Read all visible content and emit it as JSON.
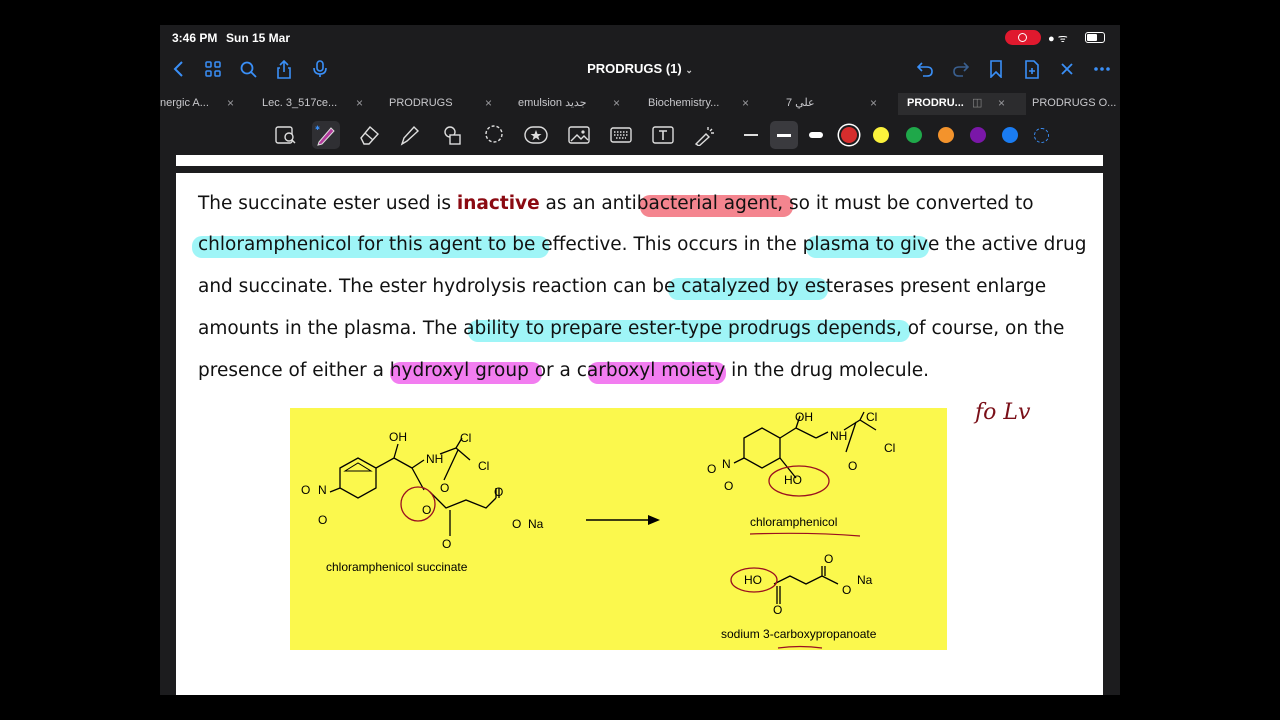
{
  "status": {
    "time": "3:46 PM",
    "date": "Sun 15 Mar"
  },
  "nav": {
    "title": "PRODRUGS (1)"
  },
  "tabs": [
    {
      "label": "nergic A..."
    },
    {
      "label": "Lec. 3_517ce..."
    },
    {
      "label": "PRODRUGS"
    },
    {
      "label": "emulsion جديد"
    },
    {
      "label": "Biochemistry..."
    },
    {
      "label": "علي 7"
    },
    {
      "label": "PRODRU..."
    },
    {
      "label": "PRODRUGS O..."
    }
  ],
  "colors": {
    "accent": "#3a8ff7",
    "pink_highlight": "#f4858f",
    "cyan_highlight": "#9ff5f7",
    "magenta_highlight": "#f27df0",
    "page_background": "#ffffff",
    "scheme_background": "#fbf84d"
  },
  "palette": [
    "#d62d2d",
    "#fbf23c",
    "#1fa84a",
    "#f3932c",
    "#7a17a8",
    "#1a7cf2"
  ],
  "document": {
    "lines": [
      [
        "The succinate ester used is ",
        "inactive",
        " as an antibacterial agent, so it must be converted to"
      ],
      [
        "chloramphenicol for this agent to be effective. This occurs in the plasma to give the active drug"
      ],
      [
        "and succinate. The ester hydrolysis reaction can be catalyzed by esterases present enlarge"
      ],
      [
        "amounts in the plasma. The ability to prepare ester-type prodrugs depends, of course, on the"
      ],
      [
        "presence of either a hydroxyl group or a carboxyl moiety in the drug molecule."
      ]
    ],
    "handwritten_note": "fo Lv",
    "scheme": {
      "reactant_label": "chloramphenicol succinate",
      "product1_label": "chloramphenicol",
      "product2_label": "sodium 3-carboxypropanoate",
      "atoms": {
        "oh": "OH",
        "nh": "NH",
        "cl": "Cl",
        "o": "O",
        "n": "N",
        "ho": "HO",
        "na": "Na"
      }
    }
  }
}
